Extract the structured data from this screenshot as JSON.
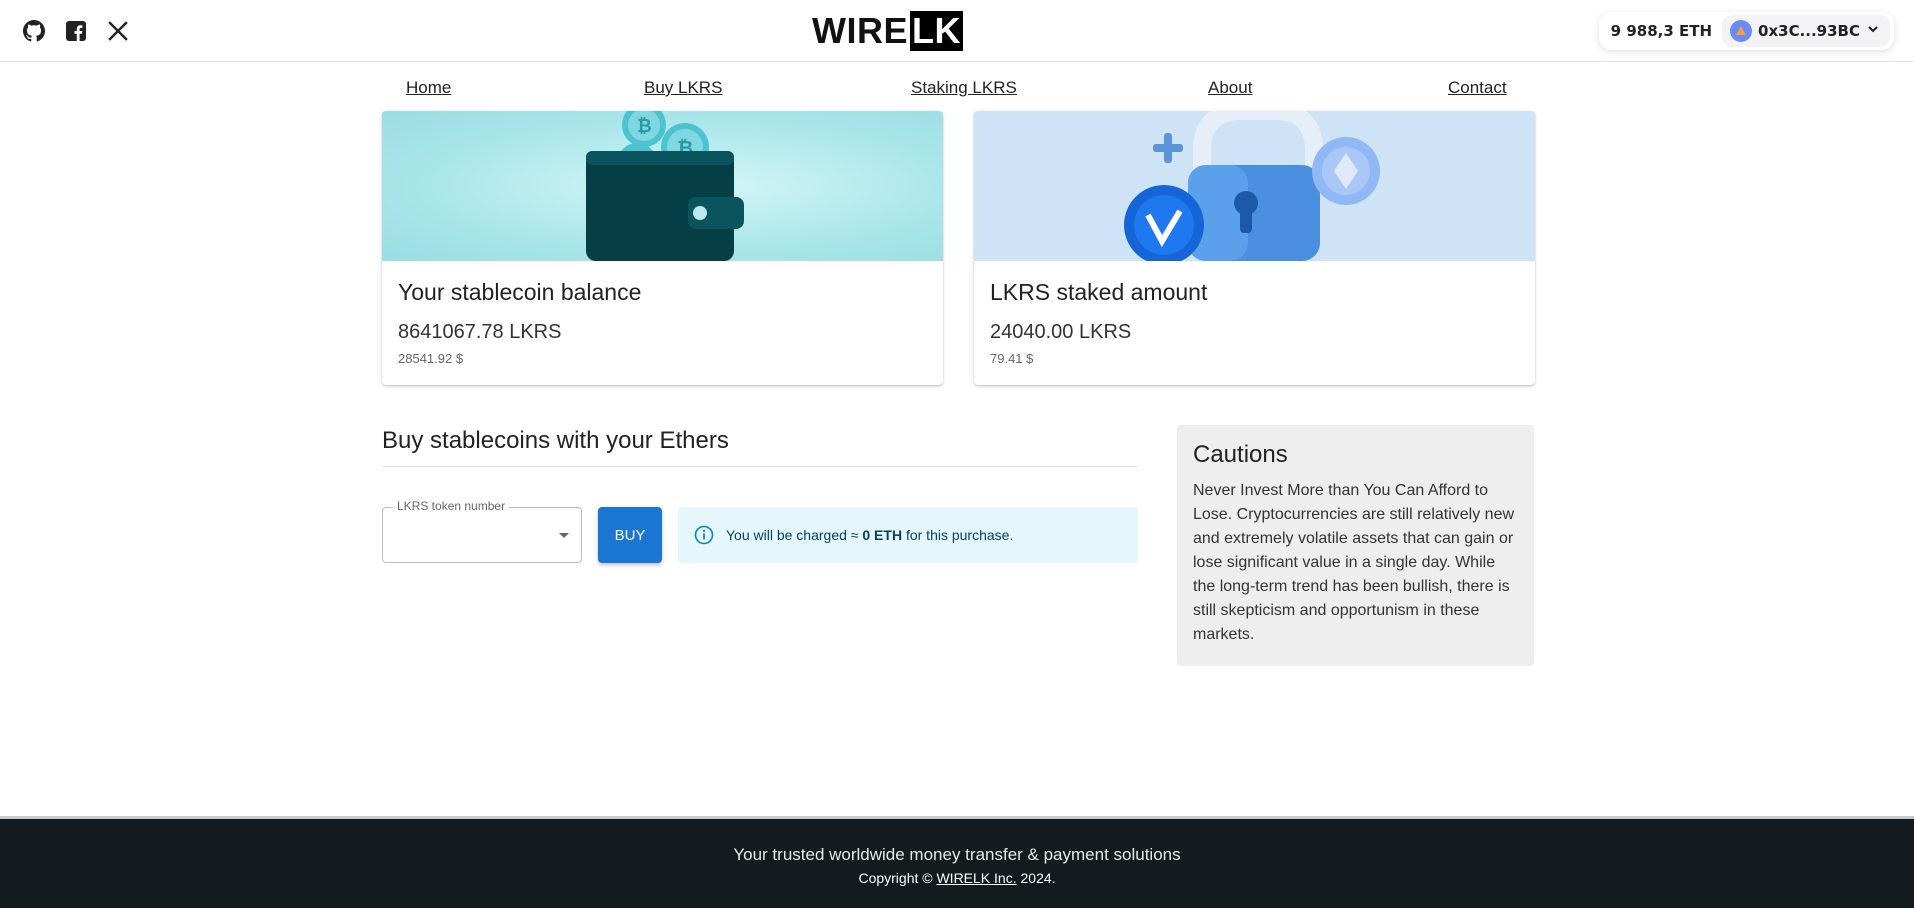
{
  "header": {
    "social_icons": [
      "github-icon",
      "facebook-icon",
      "x-icon"
    ],
    "logo": {
      "part1": "WIRE",
      "part2": "LK"
    },
    "wallet": {
      "balance": "9 988,3 ETH",
      "address": "0x3C...93BC"
    }
  },
  "nav": [
    {
      "label": "Home"
    },
    {
      "label": "Buy LKRS"
    },
    {
      "label": "Staking LKRS"
    },
    {
      "label": "About"
    },
    {
      "label": "Contact"
    }
  ],
  "cards": [
    {
      "title": "Your stablecoin balance",
      "amount": "8641067.78 LKRS",
      "usd": "28541.92 $"
    },
    {
      "title": "LKRS staked amount",
      "amount": "24040.00 LKRS",
      "usd": "79.41 $"
    }
  ],
  "buy": {
    "title": "Buy stablecoins with your Ethers",
    "field_label": "LKRS token number",
    "button": "BUY",
    "info_prefix": "You will be charged ≈ ",
    "info_amount": "0 ETH",
    "info_suffix": " for this purchase."
  },
  "caution": {
    "title": "Cautions",
    "text": "Never Invest More than You Can Afford to Lose. Cryptocurrencies are still relatively new and extremely volatile assets that can gain or lose significant value in a single day. While the long-term trend has been bullish, there is still skepticism and opportunism in these markets."
  },
  "footer": {
    "tagline": "Your trusted worldwide money transfer & payment solutions",
    "copy_prefix": "Copyright © ",
    "copy_link": "WIRELK Inc.",
    "copy_suffix": " 2024."
  },
  "colors": {
    "primary": "#1976d2",
    "info_bg": "#e5f6fd",
    "footer_bg": "#141b1e",
    "card1_bg": "#a9e6ea",
    "card2_bg": "#cfe3f7"
  }
}
